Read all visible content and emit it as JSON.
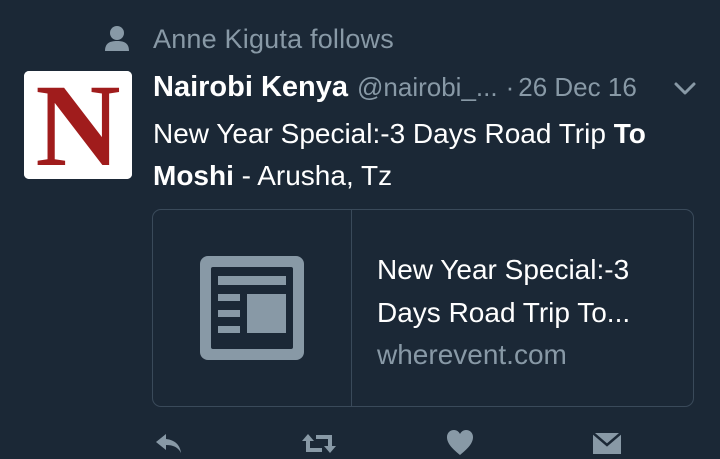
{
  "social_context": {
    "text": "Anne Kiguta follows",
    "icon": "person-icon"
  },
  "tweet": {
    "display_name": "Nairobi Kenya",
    "handle": "@nairobi_...",
    "separator": "·",
    "timestamp": "26 Dec 16",
    "avatar_letter": "N",
    "text_part1": "New Year Special:-3 Days Road Trip ",
    "text_bold1": "To",
    "text_bold2": "Moshi",
    "text_part2": " - Arusha, Tz"
  },
  "card": {
    "title": "New Year Special:-3 Days Road Trip To...",
    "domain": "wherevent.com",
    "thumb_icon": "article-icon"
  },
  "actions": {
    "icons": [
      "reply-icon",
      "retweet-icon",
      "like-icon",
      "direct-message-icon"
    ]
  },
  "colors": {
    "background": "#1b2836",
    "text_primary": "#ffffff",
    "text_secondary": "#8899a6",
    "border": "#3a4a5a",
    "avatar_red": "#a01c1c"
  }
}
